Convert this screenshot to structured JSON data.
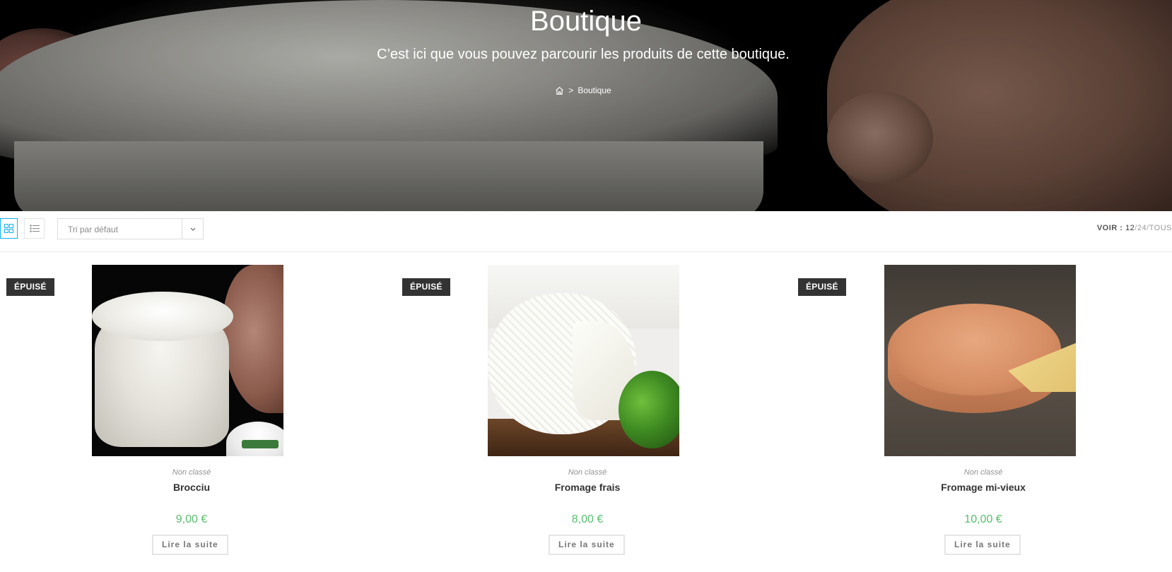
{
  "hero": {
    "title": "Boutique",
    "subtitle": "C’est ici que vous pouvez parcourir les produits de cette boutique.",
    "breadcrumb": {
      "separator": ">",
      "current": "Boutique"
    }
  },
  "toolbar": {
    "grid_icon": "grid-view-icon",
    "list_icon": "list-view-icon",
    "sort_value": "Tri par défaut",
    "voir_label": "VOIR :",
    "per_page": [
      "12",
      "24",
      "TOUS"
    ],
    "per_page_sep": "/"
  },
  "products": [
    {
      "badge": "ÉPUISÉ",
      "category": "Non classé",
      "name": "Brocciu",
      "price": "9,00 €",
      "button": "Lire la suite"
    },
    {
      "badge": "ÉPUISÉ",
      "category": "Non classé",
      "name": "Fromage frais",
      "price": "8,00 €",
      "button": "Lire la suite"
    },
    {
      "badge": "ÉPUISÉ",
      "category": "Non classé",
      "name": "Fromage mi-vieux",
      "price": "10,00 €",
      "button": "Lire la suite"
    }
  ],
  "colors": {
    "accent": "#13aff0",
    "price": "#57bf6d",
    "badge_bg": "#333333"
  }
}
